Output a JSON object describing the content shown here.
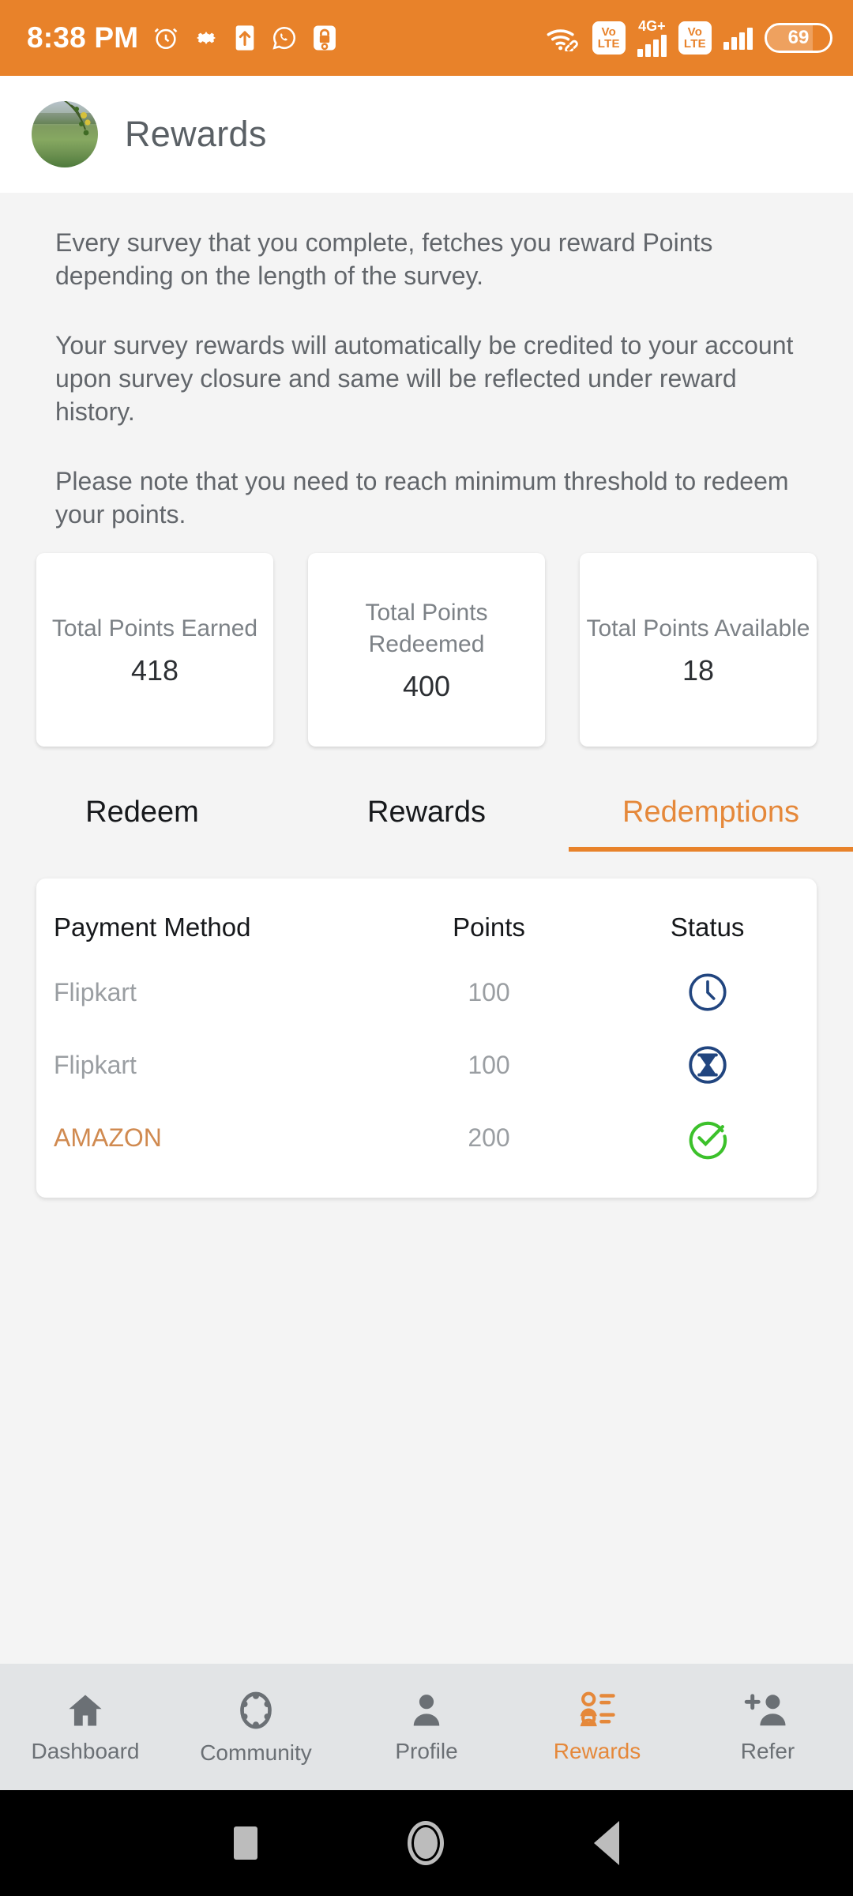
{
  "statusbar": {
    "time": "8:38 PM",
    "left_icons": [
      "alarm-icon",
      "gear-icon",
      "upload-icon",
      "whatsapp-icon",
      "app-lock-icon"
    ],
    "wifi": "wifi-icon",
    "volte_label_1": "Vo LTE",
    "network_type": "4G+",
    "volte_label_2": "Vo LTE",
    "battery_percent": "69"
  },
  "appbar": {
    "avatar": "user-avatar-landscape-photo",
    "title": "Rewards"
  },
  "intro": {
    "p1": "Every survey that you complete, fetches you reward Points depending on the length of the survey.",
    "p2": "Your survey rewards will automatically be credited to your account upon survey closure and same will be reflected under reward history.",
    "p3": "Please note that you need to reach minimum threshold to redeem your points."
  },
  "stats": [
    {
      "label": "Total Points Earned",
      "value": "418"
    },
    {
      "label": "Total Points Redeemed",
      "value": "400"
    },
    {
      "label": "Total Points Available",
      "value": "18"
    }
  ],
  "tabs": [
    {
      "label": "Redeem",
      "active": false
    },
    {
      "label": "Rewards",
      "active": false
    },
    {
      "label": "Redemptions",
      "active": true
    }
  ],
  "table": {
    "headers": [
      "Payment Method",
      "Points",
      "Status"
    ],
    "rows": [
      {
        "method": "Flipkart",
        "points": "100",
        "status": "clock-icon"
      },
      {
        "method": "Flipkart",
        "points": "100",
        "status": "hourglass-icon"
      },
      {
        "method": "AMAZON",
        "points": "200",
        "status": "check-circle-icon"
      }
    ]
  },
  "bottomnav": [
    {
      "label": "Dashboard",
      "icon": "home-icon",
      "active": false
    },
    {
      "label": "Community",
      "icon": "community-icon",
      "active": false
    },
    {
      "label": "Profile",
      "icon": "person-icon",
      "active": false
    },
    {
      "label": "Rewards",
      "icon": "rewards-list-icon",
      "active": true
    },
    {
      "label": "Refer",
      "icon": "person-add-icon",
      "active": false
    }
  ],
  "androidbar": [
    "recents-square-icon",
    "home-circle-icon",
    "back-triangle-icon"
  ],
  "colors": {
    "accent": "#e8822a",
    "accent_text": "#e5883a",
    "status_blue": "#21457f",
    "status_green": "#3cc12b",
    "amazon_text": "#d08a50",
    "page_bg": "#f4f4f4",
    "nav_bg": "#e2e4e6"
  }
}
